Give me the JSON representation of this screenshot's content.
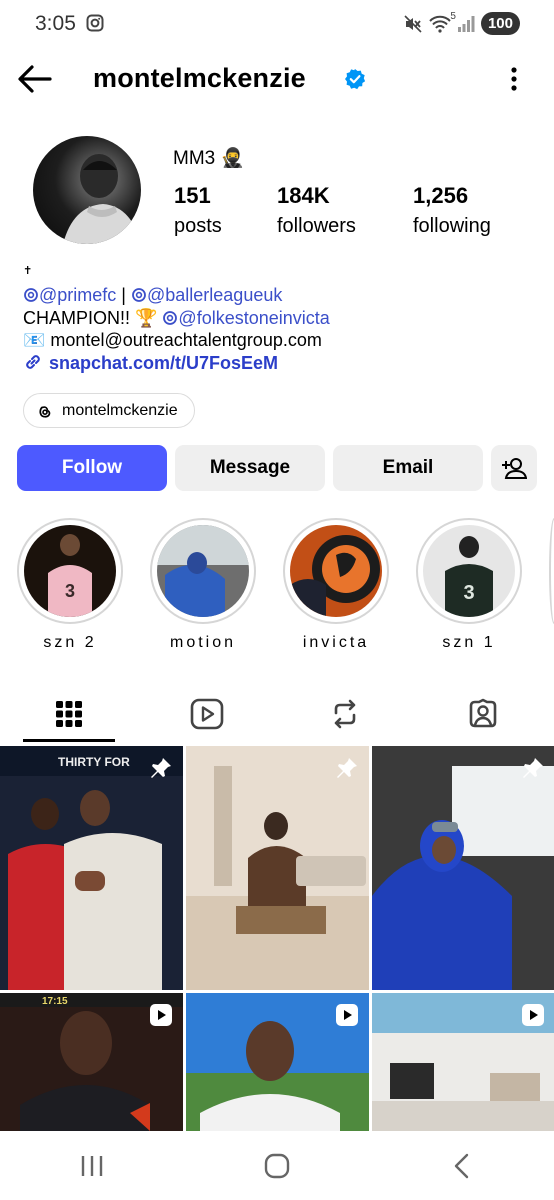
{
  "status_bar": {
    "time": "3:05",
    "battery": "100",
    "network_label": "5"
  },
  "header": {
    "username": "montelmckenzie"
  },
  "profile": {
    "display_name": "MM3 🥷",
    "stats": [
      {
        "value": "151",
        "label": "posts"
      },
      {
        "value": "184K",
        "label": "followers"
      },
      {
        "value": "1,256",
        "label": "following"
      }
    ],
    "bio": {
      "line0": "✝",
      "mention_primefc": "@primefc",
      "separator": " | ",
      "mention_ballerleague": "@ballerleagueuk",
      "champion_text": "CHAMPION!! 🏆 ",
      "mention_folkestone": "@folkestoneinvicta",
      "email_emoji": "📧 ",
      "email": "montel@outreachtalentgroup.com",
      "link": "snapchat.com/t/U7FosEeM"
    },
    "threads_handle": "montelmckenzie"
  },
  "actions": {
    "follow": "Follow",
    "message": "Message",
    "email": "Email"
  },
  "highlights": [
    {
      "label": "szn 2"
    },
    {
      "label": "motion"
    },
    {
      "label": "invicta"
    },
    {
      "label": "szn 1"
    }
  ],
  "tabs": [
    "grid-icon",
    "reels-icon",
    "reposts-icon",
    "tagged-icon"
  ],
  "grid_posts": [
    {
      "overlay_text": "THIRTY FOR",
      "badge": "pin-icon"
    },
    {
      "badge": "pin-icon"
    },
    {
      "badge": "pin-icon"
    },
    {
      "overlay_text": "17:15",
      "badge": "reel-icon"
    },
    {
      "badge": "reel-icon"
    },
    {
      "badge": "reel-icon"
    }
  ],
  "colors": {
    "accent": "#4d5aff",
    "mention": "#3b4fc9",
    "verified": "#0095f6",
    "button_bg": "#efefef"
  }
}
